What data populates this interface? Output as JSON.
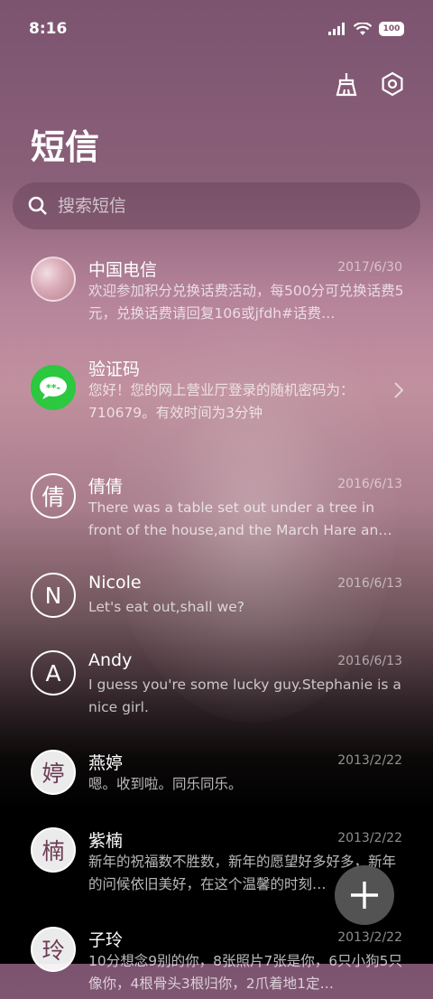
{
  "status": {
    "time": "8:16",
    "battery": "100"
  },
  "header": {
    "title": "短信"
  },
  "actions": {
    "clean_icon": "broom-icon",
    "settings_icon": "gear-icon"
  },
  "search": {
    "placeholder": "搜索短信",
    "icon": "search-icon"
  },
  "messages": [
    {
      "name": "中国电信",
      "date": "2017/6/30",
      "avatar_type": "photo",
      "avatar_text": "",
      "preview": "欢迎参加积分兑换话费活动，每500分可兑换话费5元，兑换话费请回复106或jfdh#话费…"
    },
    {
      "name": "验证码",
      "date": "",
      "avatar_type": "wechat",
      "avatar_text": "**-",
      "preview": "您好！您的网上营业厅登录的随机密码为：710679。有效时间为3分钟"
    },
    {
      "name": "倩倩",
      "date": "2016/6/13",
      "avatar_type": "letter",
      "avatar_text": "倩",
      "preview": "There was a table set out under a tree in front of the house,and the March Hare an…"
    },
    {
      "name": "Nicole",
      "date": "2016/6/13",
      "avatar_type": "letter",
      "avatar_text": "N",
      "preview": "Let's eat out,shall we?"
    },
    {
      "name": "Andy",
      "date": "2016/6/13",
      "avatar_type": "letter",
      "avatar_text": "A",
      "preview": "I guess you're some lucky guy.Stephanie is a nice girl."
    },
    {
      "name": "燕婷",
      "date": "2013/2/22",
      "avatar_type": "filled",
      "avatar_text": "婷",
      "preview": "嗯。收到啦。同乐同乐。"
    },
    {
      "name": "紫楠",
      "date": "2013/2/22",
      "avatar_type": "filled",
      "avatar_text": "楠",
      "preview": "新年的祝福数不胜数，新年的愿望好多好多，新年的问候依旧美好，在这个温馨的时刻…"
    },
    {
      "name": "子玲",
      "date": "2013/2/22",
      "avatar_type": "filled",
      "avatar_text": "玲",
      "preview": "10分想念9别的你，8张照片7张是你，6只小狗5只像你，4根骨头3根归你，2爪着地1定…"
    }
  ],
  "fab": {
    "icon": "plus-icon"
  }
}
